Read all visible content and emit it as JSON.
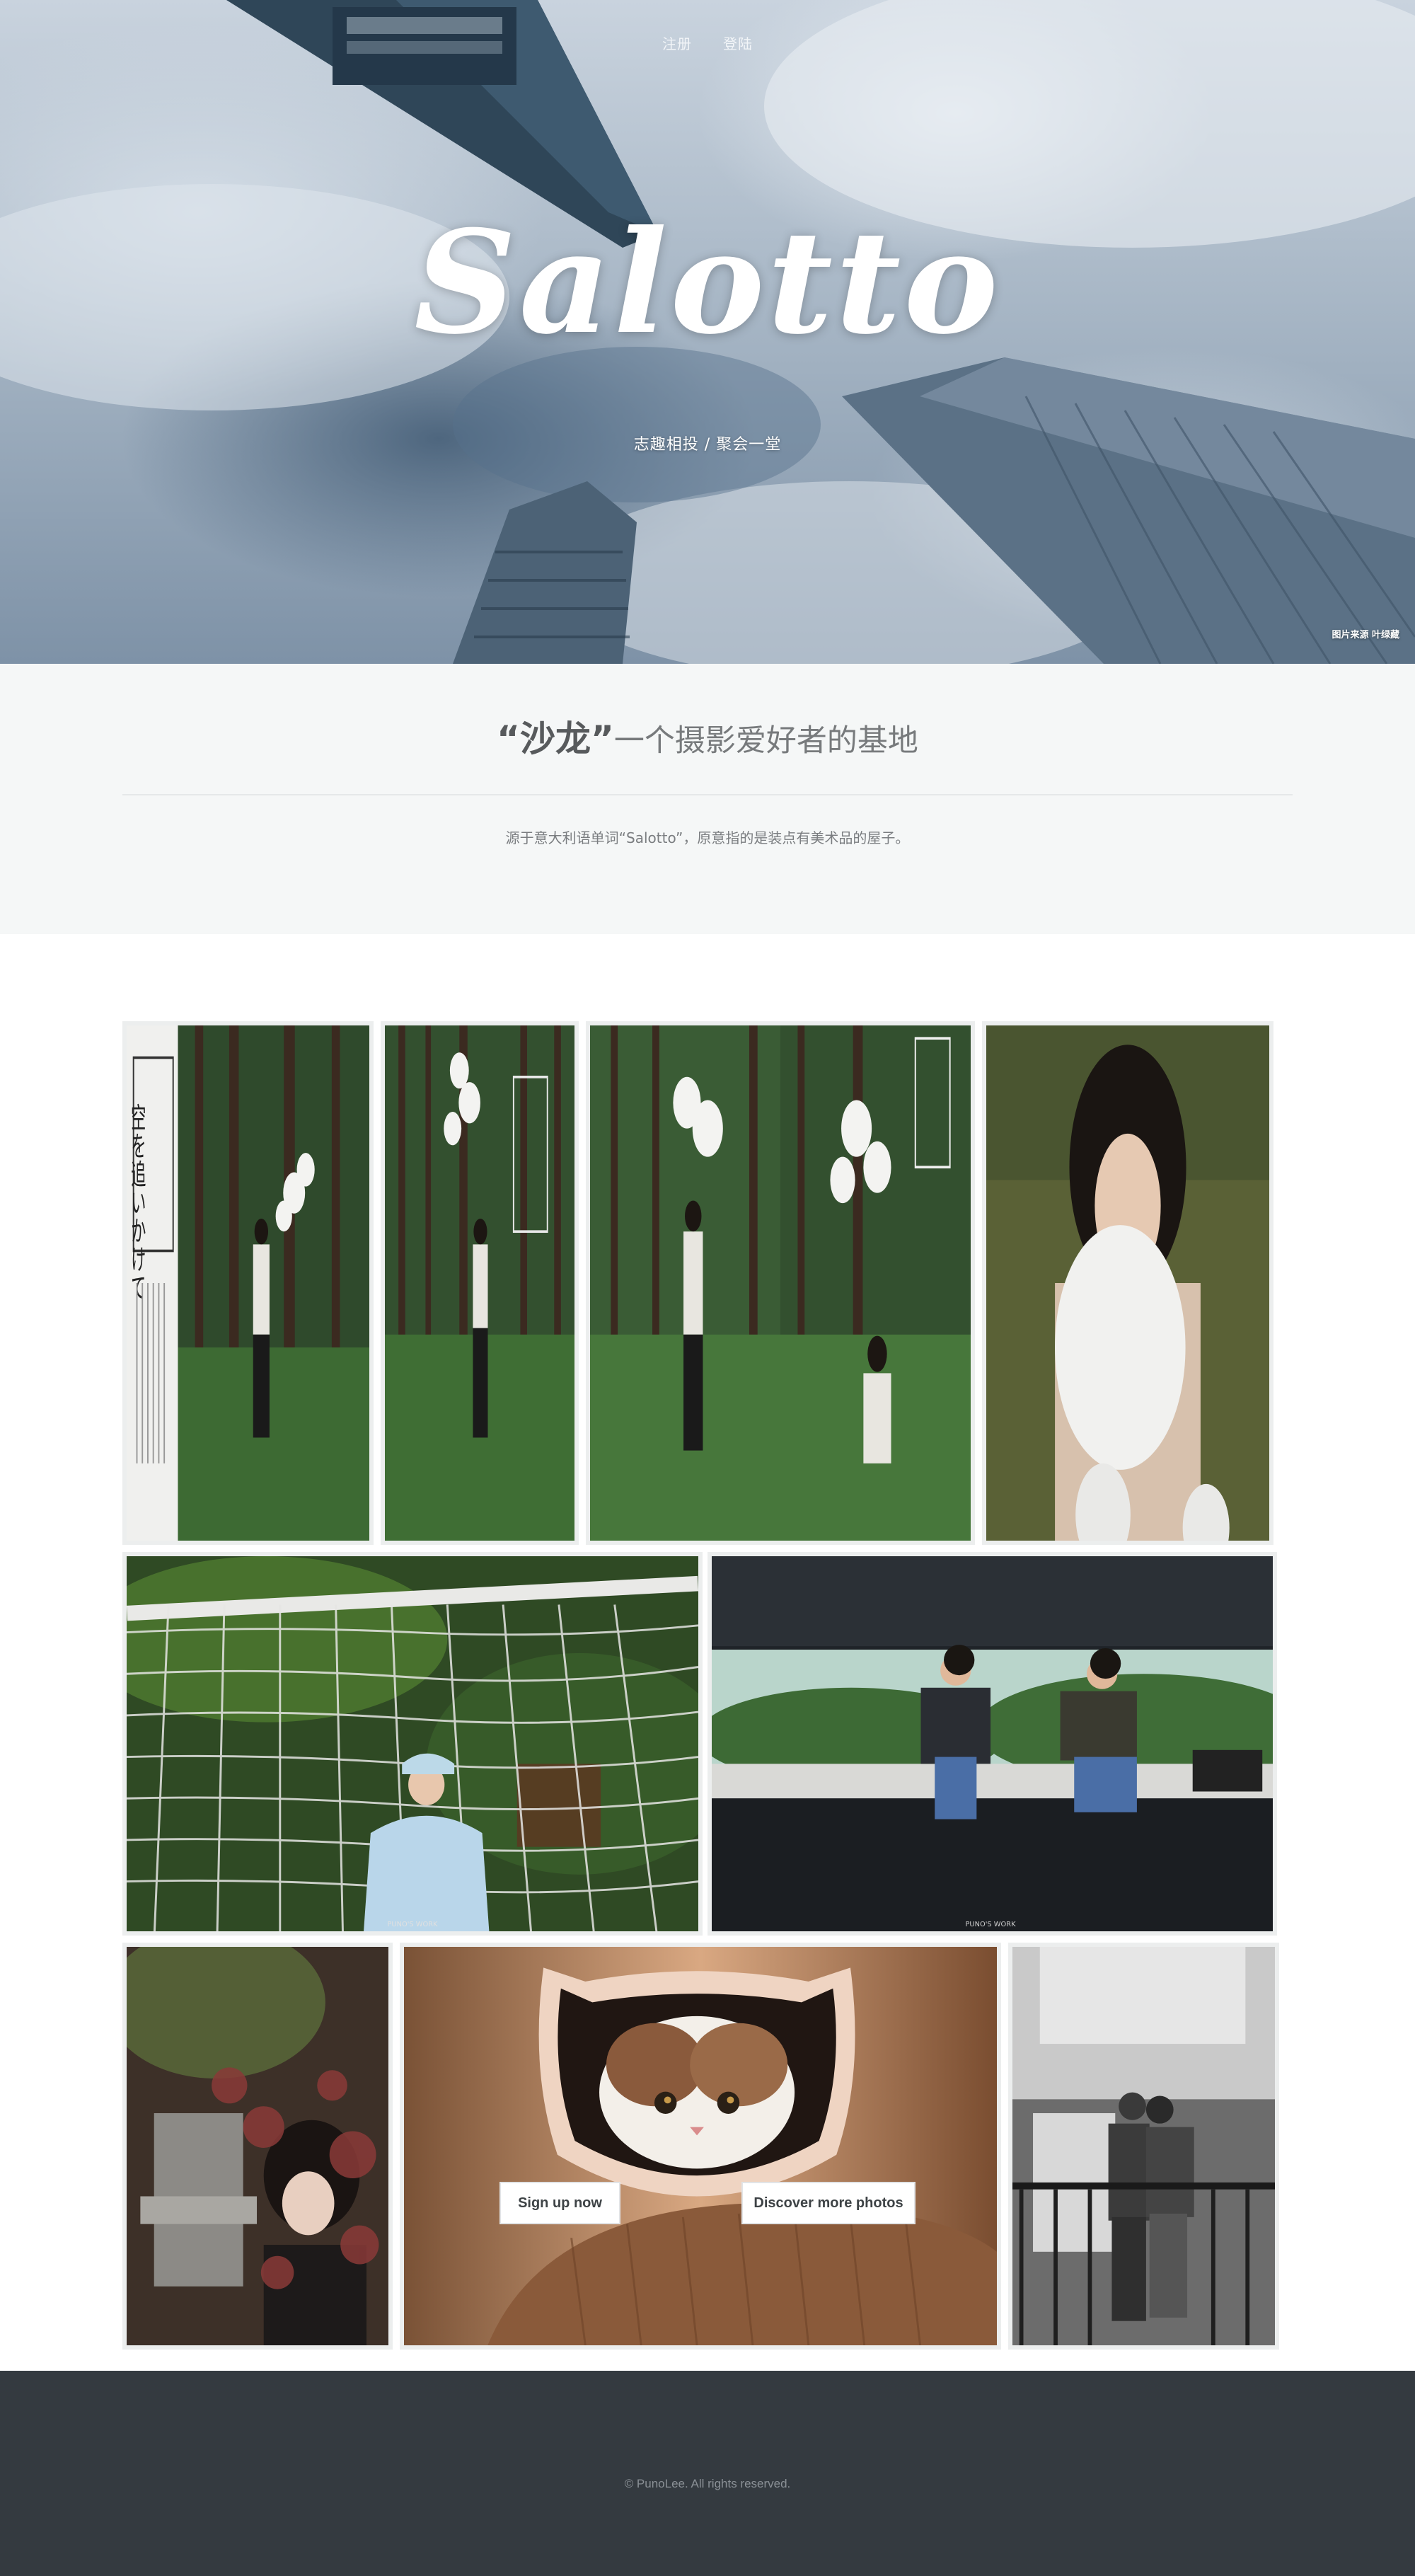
{
  "hero": {
    "nav": {
      "signup_label": "注册",
      "login_label": "登陆"
    },
    "logo_text": "Salotto",
    "tagline": "志趣相投 / 聚会一堂",
    "credit": "图片来源 叶绿藏"
  },
  "intro": {
    "title_emphasis": "“沙龙”",
    "title_rest": "一个摄影爱好者的基地",
    "description": "源于意大利语单词“Salotto”，原意指的是装点有美术品的屋子。"
  },
  "gallery": {
    "photos": [
      {
        "subject": "poster-girl-with-balloons-forest",
        "poster_text": "空を追いかけて"
      },
      {
        "subject": "girl-in-forest-with-balloons"
      },
      {
        "subject": "girl-holding-balloons-collage"
      },
      {
        "subject": "girl-hugging-white-balloon"
      },
      {
        "subject": "girl-behind-soccer-net",
        "watermark": "PUNO'S WORK"
      },
      {
        "subject": "two-men-sitting-on-ledge",
        "watermark": "PUNO'S WORK"
      },
      {
        "subject": "girl-behind-red-maple-leaves"
      },
      {
        "subject": "cat-peeking-through-cat-shaped-hole"
      },
      {
        "subject": "couple-on-balcony-black-and-white"
      }
    ]
  },
  "actions": {
    "signup_label": "Sign up now",
    "discover_label": "Discover more photos"
  },
  "footer": {
    "copyright": "© PunoLee. All rights reserved."
  },
  "colors": {
    "intro_background": "#f5f7f7",
    "footer_background": "#343a40",
    "photo_border": "#eceeee",
    "button_text": "#3e4346"
  }
}
